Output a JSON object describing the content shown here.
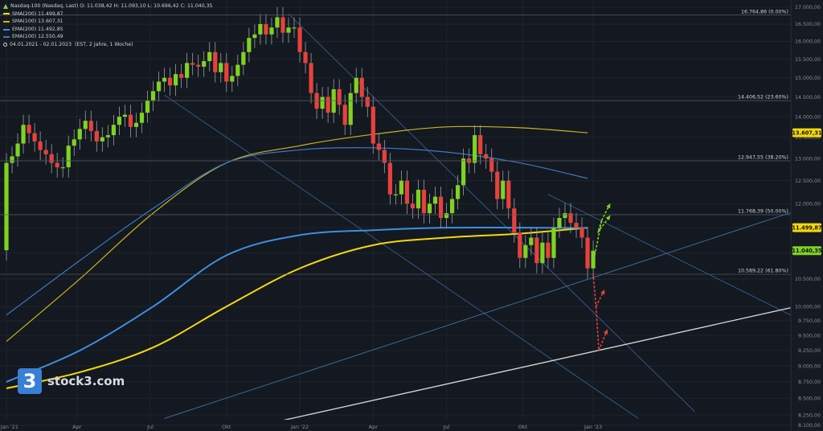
{
  "legend": {
    "title": "Nasdaq-100 (Nasdaq, Last)",
    "ohlc": "O: 11.038,42  H: 11.093,10  L: 10.696,42  C: 11.040,35",
    "sma200": "SMA(200)  11.499,87",
    "sma100": "SMA(100)  13.607,31",
    "ema200": "EMA(200)  11.492,85",
    "ema100": "EMA(100)  12.550,49",
    "period": "04.01.2021 - 02.01.2023",
    "period_note": "(EST, 2 Jahre, 1 Woche)"
  },
  "logo": {
    "mark": "3",
    "name": "stock3.com"
  },
  "colors": {
    "background": "#141820",
    "up": "#7ed321",
    "down": "#e8413c",
    "sma200": "#f5d90a",
    "sma100": "#c8b420",
    "ema200": "#3d8fe0",
    "ema100": "#3b78c2",
    "trendline": "#2e5a86",
    "support_line": "#d9d9d9"
  },
  "chart_data": {
    "type": "line",
    "title": "Nasdaq-100 (Nasdaq, Last)",
    "xlabel": "",
    "ylabel": "",
    "ylim": [
      8100,
      17000
    ],
    "y_scale": "log",
    "grid": true,
    "x_ticks": [
      {
        "label": "Jan '21",
        "week": 0
      },
      {
        "label": "Apr",
        "week": 12.5
      },
      {
        "label": "Jul",
        "week": 25.5
      },
      {
        "label": "Okt",
        "week": 39
      },
      {
        "label": "Jan '22",
        "week": 52
      },
      {
        "label": "Apr",
        "week": 65
      },
      {
        "label": "Jul",
        "week": 78
      },
      {
        "label": "Okt",
        "week": 91.5
      },
      {
        "label": "Jan '23",
        "week": 104
      }
    ],
    "y_ticks": [
      "17.000,00",
      "16.500,00",
      "16.000,00",
      "15.500,00",
      "15.000,00",
      "14.500,00",
      "14.000,00",
      "13.500,00",
      "13.000,00",
      "12.500,00",
      "12.000,00",
      "11.500,00",
      "11.000,00",
      "10.500,00",
      "10.000,00",
      "9.750,00",
      "9.500,00",
      "9.250,00",
      "9.000,00",
      "8.750,00",
      "8.500,00",
      "8.250,00",
      "8.100,00"
    ],
    "y_tick_values": [
      17000,
      16500,
      16000,
      15500,
      15000,
      14500,
      14000,
      13500,
      13000,
      12500,
      12000,
      11500,
      11000,
      10500,
      10000,
      9750,
      9500,
      9250,
      9000,
      8750,
      8500,
      8250,
      8100
    ],
    "fib_levels": [
      {
        "label": "16.764,86 (0.00%)",
        "value": 16764.86
      },
      {
        "label": "14.406,52 (23.60%)",
        "value": 14406.52
      },
      {
        "label": "12.947,55 (38.20%)",
        "value": 12947.55
      },
      {
        "label": "11.768,39 (50.00%)",
        "value": 11768.39
      },
      {
        "label": "10.589,22 (61.80%)",
        "value": 10589.22
      }
    ],
    "price_badges": [
      {
        "label": "13.607,31",
        "value": 13607.31,
        "color": "#f5d90a"
      },
      {
        "label": "11.499,87",
        "value": 11499.87,
        "color": "#f5d90a"
      },
      {
        "label": "11.040,35",
        "value": 11040.35,
        "color": "#7ed321"
      }
    ],
    "closes": [
      12900,
      13050,
      13350,
      13800,
      13600,
      13400,
      13200,
      13100,
      12900,
      12800,
      12800,
      13300,
      13450,
      13700,
      13900,
      13650,
      13400,
      13500,
      13550,
      13800,
      14000,
      14050,
      13750,
      13850,
      14100,
      14400,
      14650,
      14900,
      15000,
      14800,
      15100,
      15000,
      15400,
      15350,
      15300,
      15450,
      15700,
      15150,
      15400,
      14900,
      15050,
      15350,
      15700,
      16100,
      16200,
      16500,
      16200,
      16400,
      16700,
      16250,
      16400,
      16400,
      15700,
      15400,
      14600,
      14200,
      14500,
      14100,
      14700,
      14300,
      13800,
      14600,
      15000,
      14500,
      14250,
      13350,
      13200,
      12900,
      12200,
      12200,
      12500,
      12000,
      11900,
      12300,
      11800,
      12000,
      12150,
      11700,
      11800,
      12100,
      12400,
      13000,
      12900,
      13550,
      13100,
      13000,
      12700,
      12100,
      12500,
      11900,
      11400,
      10900,
      11150,
      11300,
      10800,
      11200,
      10900,
      11500,
      11700,
      11800,
      11600,
      11500,
      11300,
      10700,
      11040
    ],
    "candle_start": 11050,
    "series": [
      {
        "name": "SMA(200)",
        "x": [
          0,
          13,
          26,
          39,
          52,
          65,
          78,
          91,
          103
        ],
        "values": [
          8650,
          8900,
          9300,
          10000,
          10700,
          11150,
          11300,
          11380,
          11499.87
        ]
      },
      {
        "name": "SMA(100)",
        "x": [
          0,
          13,
          26,
          39,
          52,
          65,
          78,
          91,
          103
        ],
        "values": [
          9400,
          10500,
          11800,
          12900,
          13300,
          13570,
          13750,
          13730,
          13607.31
        ]
      },
      {
        "name": "EMA(200)",
        "x": [
          0,
          13,
          26,
          39,
          52,
          65,
          78,
          91,
          103
        ],
        "values": [
          8750,
          9250,
          10000,
          10950,
          11350,
          11450,
          11500,
          11500,
          11492.85
        ]
      },
      {
        "name": "EMA(100)",
        "x": [
          0,
          13,
          26,
          39,
          52,
          65,
          78,
          91,
          103
        ],
        "values": [
          9850,
          10850,
          11900,
          12900,
          13200,
          13250,
          13150,
          12900,
          12550.49
        ]
      }
    ],
    "trendlines": [
      {
        "name": "upper channel",
        "from": [
          50,
          16800
        ],
        "to": [
          122,
          8300
        ],
        "color": "#2e5a86"
      },
      {
        "name": "lower channel",
        "from": [
          28,
          14550
        ],
        "to": [
          112,
          8200
        ],
        "color": "#2e5a86"
      },
      {
        "name": "mid channel",
        "from": [
          96,
          12200
        ],
        "to": [
          140,
          9800
        ],
        "color": "#2e5a86"
      },
      {
        "name": "rising line",
        "from": [
          28,
          8200
        ],
        "to": [
          140,
          11850
        ],
        "color": "#3b6b9a"
      },
      {
        "name": "long support",
        "from": [
          45,
          8100
        ],
        "to": [
          140,
          10000
        ],
        "color": "#d9d9d9"
      }
    ],
    "scenario_arrows": [
      {
        "color": "#7ed321",
        "points": [
          [
            104,
            10800
          ],
          [
            105.5,
            11650
          ],
          [
            104.8,
            11400
          ],
          [
            107,
            11750
          ]
        ]
      },
      {
        "color": "#7ed321",
        "points": [
          [
            105.5,
            11650
          ],
          [
            107,
            12000
          ]
        ]
      },
      {
        "color": "#e8413c",
        "points": [
          [
            104,
            10600
          ],
          [
            104.5,
            10000
          ],
          [
            106,
            10300
          ]
        ]
      },
      {
        "color": "#e8413c",
        "points": [
          [
            104.5,
            10000
          ],
          [
            105,
            9250
          ],
          [
            106.5,
            9600
          ]
        ]
      }
    ]
  }
}
